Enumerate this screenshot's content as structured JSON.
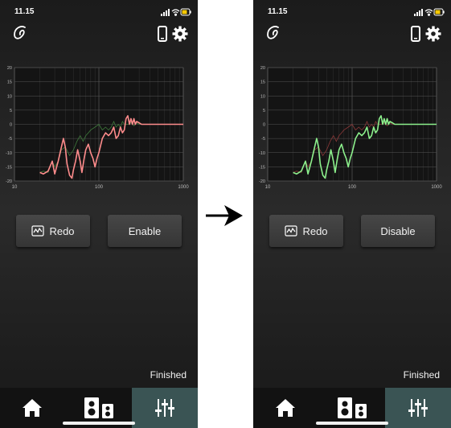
{
  "arrow_icon": "arrow-right-icon",
  "screens": [
    {
      "status_time": "11.15",
      "redo_label": "Redo",
      "toggle_label": "Enable",
      "status_text": "Finished",
      "chart": {
        "primary_color": "#ff8c8c",
        "secondary_color": "#3f7a3c"
      }
    },
    {
      "status_time": "11.15",
      "redo_label": "Redo",
      "toggle_label": "Disable",
      "status_text": "Finished",
      "chart": {
        "primary_color": "#8cf08c",
        "secondary_color": "#8a3838"
      }
    }
  ],
  "chart_data": {
    "type": "line",
    "x_scale": "log",
    "xlim": [
      10,
      1000
    ],
    "ylim": [
      -20,
      20
    ],
    "x_ticks": [
      "10",
      "100",
      "1000"
    ],
    "y_ticks": [
      "20",
      "15",
      "10",
      "5",
      "0",
      "-5",
      "-10",
      "-15",
      "-20"
    ],
    "grid": true,
    "series": [
      {
        "x": [
          20,
          22,
          25,
          28,
          30,
          33,
          36,
          38,
          40,
          42,
          45,
          48,
          50,
          53,
          56,
          60,
          63,
          67,
          70,
          75,
          80,
          85,
          90,
          95,
          100,
          110,
          120,
          130,
          140,
          150,
          160,
          170,
          180,
          190,
          200,
          210,
          220,
          230,
          240,
          250,
          260,
          270,
          280,
          300,
          320,
          350,
          400,
          500,
          600,
          800,
          1000
        ],
        "values": [
          -17,
          -17.5,
          -16.5,
          -13,
          -17.5,
          -13,
          -8,
          -5,
          -8,
          -14,
          -18,
          -19,
          -16,
          -13,
          -9,
          -13,
          -17,
          -12,
          -9,
          -7,
          -10,
          -12,
          -15,
          -12,
          -10,
          -5,
          -3,
          -4,
          -3,
          -1,
          -5,
          -4,
          -1,
          -3,
          -2,
          2,
          3,
          0,
          2,
          0,
          2,
          0,
          1,
          0.5,
          0,
          0,
          0,
          0,
          0,
          0,
          0
        ]
      },
      {
        "x": [
          20,
          22,
          25,
          28,
          30,
          33,
          36,
          40,
          45,
          50,
          55,
          60,
          65,
          70,
          75,
          80,
          90,
          100,
          110,
          120,
          130,
          140,
          150,
          160,
          170,
          180,
          190,
          200,
          220,
          240,
          260,
          280,
          300,
          350,
          400,
          500,
          600,
          800,
          1000
        ],
        "values": [
          -17,
          -16.5,
          -17,
          -13,
          -15,
          -13,
          -9,
          -8,
          -11,
          -9,
          -6,
          -4,
          -6,
          -4,
          -3,
          -2,
          -1,
          0,
          -2,
          -1,
          -2,
          -1,
          1,
          -1,
          0,
          -1,
          1,
          0,
          0,
          0.5,
          -0.5,
          0.5,
          0,
          0,
          0,
          0,
          0,
          0,
          0
        ]
      }
    ]
  }
}
